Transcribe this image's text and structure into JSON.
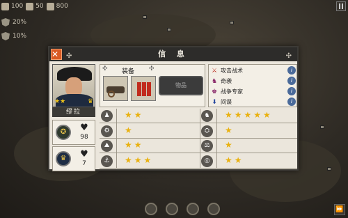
{
  "hud": {
    "resource1": "100",
    "resource2": "50",
    "resource3": "800",
    "stat1": "20%",
    "stat2": "10%"
  },
  "dialog": {
    "title": "信 息",
    "close_symbol": "✕",
    "general_name": "缪拉",
    "equipment_header": "装备",
    "item_button": "物品",
    "medals": [
      {
        "icon": "army-medal-icon",
        "value": "98"
      },
      {
        "icon": "crown-medal-icon",
        "value": "7"
      }
    ],
    "traits": [
      {
        "label": "攻击战术",
        "color": "#c0392b"
      },
      {
        "label": "奇袭",
        "color": "#8a2a6a"
      },
      {
        "label": "战争专家",
        "color": "#8a2a6a"
      },
      {
        "label": "间谍",
        "color": "#2a4aa0"
      }
    ],
    "stats_left": [
      {
        "icon": "infantry-icon",
        "stars": 2
      },
      {
        "icon": "artillery-icon",
        "stars": 1
      },
      {
        "icon": "tank-icon",
        "stars": 2
      },
      {
        "icon": "navy-icon",
        "stars": 3
      }
    ],
    "stats_right": [
      {
        "icon": "cavalry-icon",
        "stars": 5
      },
      {
        "icon": "supply-icon",
        "stars": 1
      },
      {
        "icon": "justice-icon",
        "stars": 1
      },
      {
        "icon": "defense-icon",
        "stars": 2
      }
    ]
  }
}
